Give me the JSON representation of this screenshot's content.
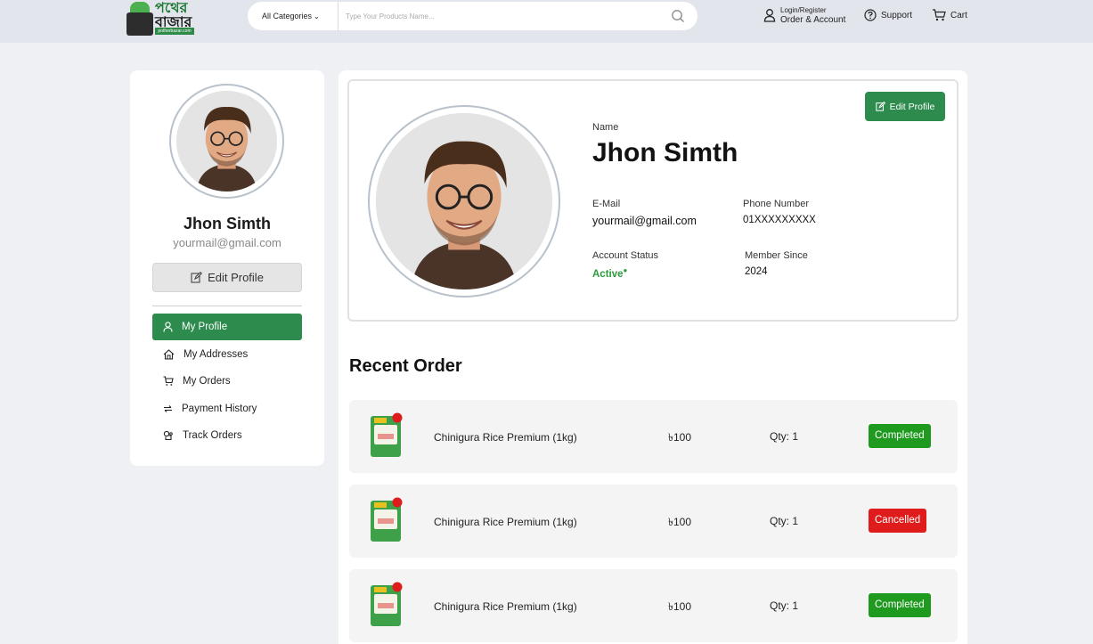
{
  "header": {
    "logo_line1": "পথের",
    "logo_line2": "বাজার",
    "logo_url_text": "potherbazar.com",
    "category_label": "All Categories",
    "search_placeholder": "Type Your Products Name...",
    "account_top": "Login/Register",
    "account_bottom": "Order & Account",
    "support_label": "Support",
    "cart_label": "Cart"
  },
  "sidebar": {
    "name": "Jhon Simth",
    "email": "yourmail@gmail.com",
    "edit_label": "Edit Profile",
    "menu": [
      {
        "label": "My Profile",
        "icon": "user-icon",
        "active": true
      },
      {
        "label": "My Addresses",
        "icon": "home-icon",
        "active": false
      },
      {
        "label": "My Orders",
        "icon": "cart-icon",
        "active": false
      },
      {
        "label": "Payment History",
        "icon": "swap-icon",
        "active": false
      },
      {
        "label": "Track Orders",
        "icon": "track-icon",
        "active": false
      }
    ]
  },
  "profile": {
    "edit_label": "Edit Profile",
    "name_label": "Name",
    "name": "Jhon Simth",
    "email_label": "E-Mail",
    "email": "yourmail@gmail.com",
    "phone_label": "Phone Number",
    "phone": "01XXXXXXXXX",
    "status_label": "Account Status",
    "status": "Active",
    "since_label": "Member Since",
    "since": "2024"
  },
  "recent_orders": {
    "title": "Recent Order",
    "orders": [
      {
        "product": "Chinigura Rice Premium (1kg)",
        "price": "৳100",
        "qty": "Qty: 1",
        "status": "Completed",
        "status_color": "#1e9a1e"
      },
      {
        "product": "Chinigura Rice Premium (1kg)",
        "price": "৳100",
        "qty": "Qty: 1",
        "status": "Cancelled",
        "status_color": "#e01b1b"
      },
      {
        "product": "Chinigura Rice Premium (1kg)",
        "price": "৳100",
        "qty": "Qty: 1",
        "status": "Completed",
        "status_color": "#1e9a1e"
      }
    ]
  },
  "colors": {
    "brand_green": "#2e8b4e",
    "completed": "#1e9a1e",
    "cancelled": "#e01b1b",
    "active_text": "#2a9a3a"
  }
}
